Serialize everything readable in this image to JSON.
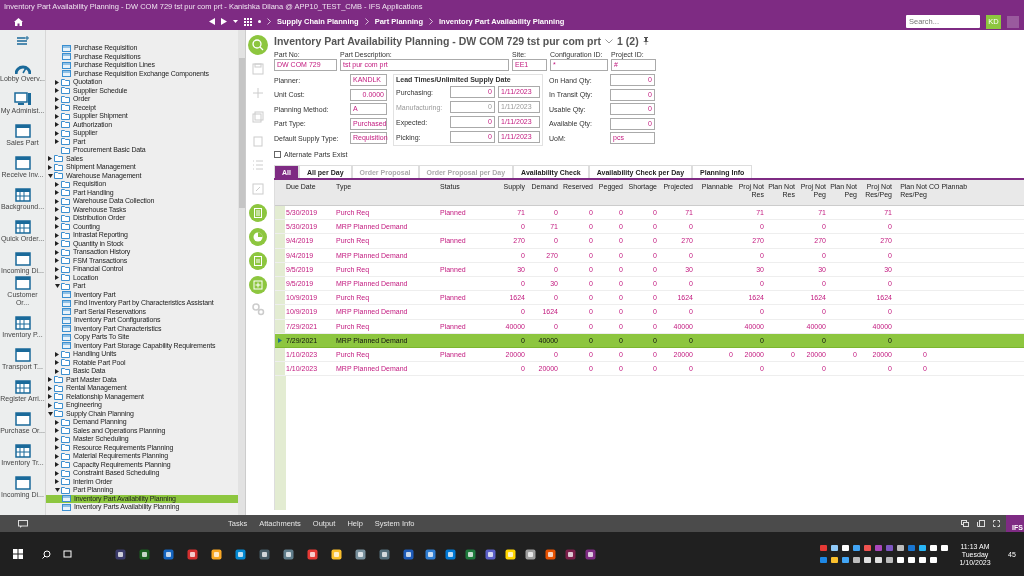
{
  "window": {
    "title": "Inventory Part Availability Planning - DW COM 729 tst pur com prt - Kanishka Dilana @ APP10_TEST_CMB - IFS Applications"
  },
  "nav": {
    "breadcrumbs": [
      "Supply Chain Planning",
      "Part Planning",
      "Inventory Part Availability Planning"
    ],
    "search": {
      "placeholder": "Search..."
    },
    "avatar": "KD"
  },
  "rail": [
    {
      "label": "Lobby Overv...",
      "kind": "gauge"
    },
    {
      "label": "My Administ...",
      "kind": "monitor"
    },
    {
      "label": "Sales Part",
      "kind": "window"
    },
    {
      "label": "Receive Inv...",
      "kind": "window"
    },
    {
      "label": "Background...",
      "kind": "grid"
    },
    {
      "label": "Quick Order...",
      "kind": "grid"
    },
    {
      "label": "Incoming Di...",
      "kind": "window"
    },
    {
      "label": "Customer Or...",
      "kind": "window"
    },
    {
      "label": "Inventory P...",
      "kind": "grid"
    },
    {
      "label": "Transport T...",
      "kind": "window"
    },
    {
      "label": "Register Arri...",
      "kind": "grid"
    },
    {
      "label": "Purchase Or...",
      "kind": "window"
    },
    {
      "label": "Inventory Tr...",
      "kind": "grid"
    },
    {
      "label": "Incoming Di...",
      "kind": "window"
    }
  ],
  "tree": {
    "leading": [
      {
        "label": "Purchase Requisition",
        "kind": "form",
        "selected": false
      },
      {
        "label": "Purchase Requisitions",
        "kind": "form",
        "selected": false
      },
      {
        "label": "Purchase Requisition Lines",
        "kind": "form",
        "selected": false
      },
      {
        "label": "Purchase Requisition Exchange Components",
        "kind": "form",
        "selected": false
      }
    ],
    "siblings": [
      {
        "label": "Quotation",
        "kind": "folder",
        "expanded": false
      },
      {
        "label": "Supplier Schedule",
        "kind": "folder",
        "expanded": false
      },
      {
        "label": "Order",
        "kind": "folder",
        "expanded": false
      },
      {
        "label": "Receipt",
        "kind": "folder",
        "expanded": false
      },
      {
        "label": "Supplier Shipment",
        "kind": "folder",
        "expanded": false
      },
      {
        "label": "Authorization",
        "kind": "folder",
        "expanded": false
      },
      {
        "label": "Supplier",
        "kind": "folder",
        "expanded": false
      },
      {
        "label": "Part",
        "kind": "folder",
        "expanded": false
      },
      {
        "label": "Procurement Basic Data",
        "kind": "folder"
      }
    ],
    "items": [
      {
        "label": "Sales",
        "kind": "folder",
        "expanded": false
      },
      {
        "label": "Shipment Management",
        "kind": "folder",
        "expanded": false
      },
      {
        "label": "Warehouse Management",
        "kind": "folder",
        "expanded": true,
        "children": [
          {
            "label": "Requisition",
            "kind": "folder",
            "expanded": false
          },
          {
            "label": "Part Handling",
            "kind": "folder",
            "expanded": false
          },
          {
            "label": "Warehouse Data Collection",
            "kind": "folder",
            "expanded": false
          },
          {
            "label": "Warehouse Tasks",
            "kind": "folder",
            "expanded": false
          },
          {
            "label": "Distribution Order",
            "kind": "folder",
            "expanded": false
          },
          {
            "label": "Counting",
            "kind": "folder",
            "expanded": false
          },
          {
            "label": "Intrastat Reporting",
            "kind": "folder",
            "expanded": false
          },
          {
            "label": "Quantity in Stock",
            "kind": "folder",
            "expanded": false
          },
          {
            "label": "Transaction History",
            "kind": "folder",
            "expanded": false
          },
          {
            "label": "FSM Transactions",
            "kind": "folder",
            "expanded": false
          },
          {
            "label": "Financial Control",
            "kind": "folder",
            "expanded": false
          },
          {
            "label": "Location",
            "kind": "folder",
            "expanded": false
          },
          {
            "label": "Part",
            "kind": "folder",
            "expanded": true,
            "children": [
              {
                "label": "Inventory Part",
                "kind": "form",
                "selected": false
              },
              {
                "label": "Find Inventory Part by Characteristics Assistant",
                "kind": "form",
                "selected": false
              },
              {
                "label": "Part Serial Reservations",
                "kind": "form",
                "selected": false
              },
              {
                "label": "Inventory Part Configurations",
                "kind": "form",
                "selected": false
              },
              {
                "label": "Inventory Part Characteristics",
                "kind": "form",
                "selected": false
              },
              {
                "label": "Copy Parts To Site",
                "kind": "form",
                "selected": false
              },
              {
                "label": "Inventory Part Storage Capability Requirements",
                "kind": "form",
                "selected": false
              }
            ]
          },
          {
            "label": "Handling Units",
            "kind": "folder",
            "expanded": false
          },
          {
            "label": "Rotable Part Pool",
            "kind": "folder",
            "expanded": false
          },
          {
            "label": "Basic Data",
            "kind": "folder",
            "expanded": false
          }
        ]
      },
      {
        "label": "Part Master Data",
        "kind": "folder",
        "expanded": false
      },
      {
        "label": "Rental Management",
        "kind": "folder",
        "expanded": false
      },
      {
        "label": "Relationship Management",
        "kind": "folder",
        "expanded": false
      },
      {
        "label": "Engineering",
        "kind": "folder",
        "expanded": false
      },
      {
        "label": "Supply Chain Planning",
        "kind": "folder",
        "expanded": true,
        "children": [
          {
            "label": "Demand Planning",
            "kind": "folder",
            "expanded": false
          },
          {
            "label": "Sales and Operations Planning",
            "kind": "folder",
            "expanded": false
          },
          {
            "label": "Master Scheduling",
            "kind": "folder",
            "expanded": false
          },
          {
            "label": "Resource Requirements Planning",
            "kind": "folder",
            "expanded": false
          },
          {
            "label": "Material Requirements Planning",
            "kind": "folder",
            "expanded": false
          },
          {
            "label": "Capacity Requirements Planning",
            "kind": "folder",
            "expanded": false
          },
          {
            "label": "Constraint Based Scheduling",
            "kind": "folder",
            "expanded": false
          },
          {
            "label": "Interim Order",
            "kind": "folder",
            "expanded": false
          },
          {
            "label": "Part Planning",
            "kind": "folder",
            "expanded": true,
            "children": [
              {
                "label": "Inventory Part Availability Planning",
                "kind": "form",
                "selected": true
              },
              {
                "label": "Inventory Parts Availability Planning",
                "kind": "form",
                "selected": false
              }
            ]
          }
        ]
      }
    ]
  },
  "page": {
    "title": "Inventory Part Availability Planning - DW COM 729 tst pur com prt",
    "record": "1 (2)"
  },
  "header": {
    "top": [
      {
        "label": "Part No:",
        "value": "DW COM 729"
      },
      {
        "label": "Part Description:",
        "value": "tst pur com prt"
      },
      {
        "label": "Site:",
        "value": "EE1"
      },
      {
        "label": "Configuration ID:",
        "value": "*"
      },
      {
        "label": "Project ID:",
        "value": "#"
      }
    ],
    "left": [
      {
        "label": "Planner:",
        "value": "KANDLK"
      },
      {
        "label": "Unit Cost:",
        "value": "0.0000",
        "numeric": true
      },
      {
        "label": "Planning Method:",
        "value": "A"
      },
      {
        "label": "Part Type:",
        "value": "Purchased"
      },
      {
        "label": "Default Supply Type:",
        "value": "Requisition"
      }
    ],
    "lead_times": {
      "title": "Lead Times/Unlimited Supply Date",
      "rows": [
        {
          "label": "Purchasing:",
          "days": "0",
          "date": "1/11/2023",
          "disabled": false
        },
        {
          "label": "Manufacturing:",
          "days": "0",
          "date": "1/11/2023",
          "disabled": true
        },
        {
          "label": "Expected:",
          "days": "0",
          "date": "1/11/2023",
          "disabled": false
        },
        {
          "label": "Picking:",
          "days": "0",
          "date": "1/11/2023",
          "disabled": false
        }
      ]
    },
    "right": [
      {
        "label": "On Hand Qty:",
        "value": "0",
        "numeric": true
      },
      {
        "label": "In Transit Qty:",
        "value": "0",
        "numeric": true
      },
      {
        "label": "Usable Qty:",
        "value": "0",
        "numeric": true
      },
      {
        "label": "Available Qty:",
        "value": "0",
        "numeric": true
      },
      {
        "label": "UoM:",
        "value": "pcs"
      }
    ],
    "alternate": {
      "label": "Alternate Parts Exist",
      "checked": false
    }
  },
  "tabs": [
    {
      "label": "All",
      "selected": true,
      "disabled": false
    },
    {
      "label": "All per Day",
      "selected": false,
      "disabled": false
    },
    {
      "label": "Order Proposal",
      "selected": false,
      "disabled": true
    },
    {
      "label": "Order Proposal per Day",
      "selected": false,
      "disabled": true
    },
    {
      "label": "Availability Check",
      "selected": false,
      "disabled": false
    },
    {
      "label": "Availability Check per Day",
      "selected": false,
      "disabled": false
    },
    {
      "label": "Planning Info",
      "selected": false,
      "disabled": false
    }
  ],
  "table": {
    "columns": [
      "Due Date",
      "Type",
      "Status",
      "Supply",
      "Demand",
      "Reserved",
      "Pegged",
      "Shortage",
      "Projected",
      "Plannable",
      "Proj Not Res",
      "Plan Not Res",
      "Proj Not Peg",
      "Plan Not Peg",
      "Proj Not Res/Peg",
      "Plan Not Res/Peg",
      "CO Plannab"
    ],
    "rows": [
      {
        "selected": false,
        "cells": [
          "5/30/2019",
          "Purch Req",
          "Planned",
          "71",
          "0",
          "0",
          "0",
          "0",
          "71",
          null,
          "71",
          null,
          "71",
          null,
          "71",
          null,
          null
        ]
      },
      {
        "selected": false,
        "cells": [
          "5/30/2019",
          "MRP Planned Demand",
          null,
          "0",
          "71",
          "0",
          "0",
          "0",
          "0",
          null,
          "0",
          null,
          "0",
          null,
          "0",
          null,
          null
        ]
      },
      {
        "selected": false,
        "cells": [
          "9/4/2019",
          "Purch Req",
          "Planned",
          "270",
          "0",
          "0",
          "0",
          "0",
          "270",
          null,
          "270",
          null,
          "270",
          null,
          "270",
          null,
          null
        ]
      },
      {
        "selected": false,
        "cells": [
          "9/4/2019",
          "MRP Planned Demand",
          null,
          "0",
          "270",
          "0",
          "0",
          "0",
          "0",
          null,
          "0",
          null,
          "0",
          null,
          "0",
          null,
          null
        ]
      },
      {
        "selected": false,
        "cells": [
          "9/5/2019",
          "Purch Req",
          "Planned",
          "30",
          "0",
          "0",
          "0",
          "0",
          "30",
          null,
          "30",
          null,
          "30",
          null,
          "30",
          null,
          null
        ]
      },
      {
        "selected": false,
        "cells": [
          "9/5/2019",
          "MRP Planned Demand",
          null,
          "0",
          "30",
          "0",
          "0",
          "0",
          "0",
          null,
          "0",
          null,
          "0",
          null,
          "0",
          null,
          null
        ]
      },
      {
        "selected": false,
        "cells": [
          "10/9/2019",
          "Purch Req",
          "Planned",
          "1624",
          "0",
          "0",
          "0",
          "0",
          "1624",
          null,
          "1624",
          null,
          "1624",
          null,
          "1624",
          null,
          null
        ]
      },
      {
        "selected": false,
        "cells": [
          "10/9/2019",
          "MRP Planned Demand",
          null,
          "0",
          "1624",
          "0",
          "0",
          "0",
          "0",
          null,
          "0",
          null,
          "0",
          null,
          "0",
          null,
          null
        ]
      },
      {
        "selected": false,
        "cells": [
          "7/29/2021",
          "Purch Req",
          "Planned",
          "40000",
          "0",
          "0",
          "0",
          "0",
          "40000",
          null,
          "40000",
          null,
          "40000",
          null,
          "40000",
          null,
          null
        ]
      },
      {
        "selected": true,
        "cells": [
          "7/29/2021",
          "MRP Planned Demand",
          null,
          "0",
          "40000",
          "0",
          "0",
          "0",
          "0",
          null,
          "0",
          null,
          "0",
          null,
          "0",
          null,
          null
        ]
      },
      {
        "selected": false,
        "cells": [
          "1/10/2023",
          "Purch Req",
          "Planned",
          "20000",
          "0",
          "0",
          "0",
          "0",
          "20000",
          "0",
          "20000",
          "0",
          "20000",
          "0",
          "20000",
          "0",
          null
        ]
      },
      {
        "selected": false,
        "cells": [
          "1/10/2023",
          "MRP Planned Demand",
          null,
          "0",
          "20000",
          "0",
          "0",
          "0",
          "0",
          null,
          "0",
          null,
          "0",
          null,
          "0",
          "0",
          null
        ]
      }
    ]
  },
  "bottom_bar": {
    "links": [
      "Tasks",
      "Attachments",
      "Output",
      "Help",
      "System Info"
    ],
    "badge": "IFS"
  },
  "taskbar": {
    "time": "11:13 AM",
    "day": "Tuesday",
    "date": "1/10/2023",
    "notifications": "45"
  }
}
